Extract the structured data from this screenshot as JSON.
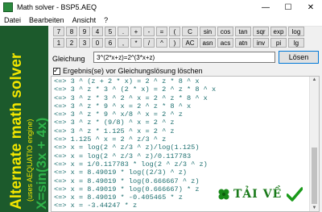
{
  "window": {
    "title": "Math solver - BSP5.AEQ",
    "minimize": "—",
    "maximize": "☐",
    "close": "✕"
  },
  "menu": [
    "Datei",
    "Bearbeiten",
    "Ansicht",
    "?"
  ],
  "sidebar": {
    "line1": "Alternate math solver",
    "line2": "(uses AEQUATIO engine)",
    "line3": "X=sin(3x + 4x)"
  },
  "keypad": {
    "row1": [
      "7",
      "8",
      "9",
      "4",
      "5",
      ".",
      "+",
      "-",
      "=",
      "(",
      "C",
      "sin",
      "cos",
      "tan",
      "sqr",
      "exp",
      "log"
    ],
    "row2": [
      "1",
      "2",
      "3",
      "0",
      "6",
      ",",
      "*",
      "/",
      "^",
      ")",
      "AC",
      "asn",
      "acs",
      "atn",
      "inv",
      "pi",
      "lg"
    ]
  },
  "equation": {
    "label": "Gleichung",
    "value": "3^(2*x+z)=2^(3*x+z)",
    "solve_label": "Lösen"
  },
  "options": {
    "clear_label": "Ergebnis(se) vor Gleichungslösung löschen",
    "checked": true
  },
  "output_lines": [
    "<=> 3 ^ (z + 2 * x) = 2 ^ z * 8 ^ x",
    "<=> 3 ^ z * 3 ^ (2 * x) = 2 ^ z * 8 ^ x",
    "<=> 3 ^ z * 3 ^ 2 ^ x = 2 ^ z * 8 ^ x",
    "<=> 3 ^ z * 9 ^ x = 2 ^ z * 8 ^ x",
    "<=> 3 ^ z * 9 ^ x/8 ^ x = 2 ^ z",
    "<=> 3 ^ z * (9/8) ^ x = 2 ^ z",
    "<=> 3 ^ z * 1.125 ^ x = 2 ^ z",
    "<=> 1.125 ^ x = 2 ^ z/3 ^ z",
    "<=> x = log(2 ^ z/3 ^ z)/log(1.125)",
    "<=> x = log(2 ^ z/3 ^ z)/0.117783",
    "<=> x = 1/0.117783 * log(2 ^ z/3 ^ z)",
    "<=> x = 8.49019 * log((2/3) ^ z)",
    "<=> x = 8.49019 * log(0.666667 ^ z)",
    "<=> x = 8.49019 * log(0.666667) * z",
    "<=> x = 8.49019 * -0.405465 * z",
    "<=> x = -3.44247 * z"
  ],
  "watermark": {
    "text": "TẢI VỀ"
  },
  "colors": {
    "sidebar_bg": "#1c5a2c",
    "sidebar_text": "#f2e600",
    "output_text": "#1d6f6f"
  }
}
